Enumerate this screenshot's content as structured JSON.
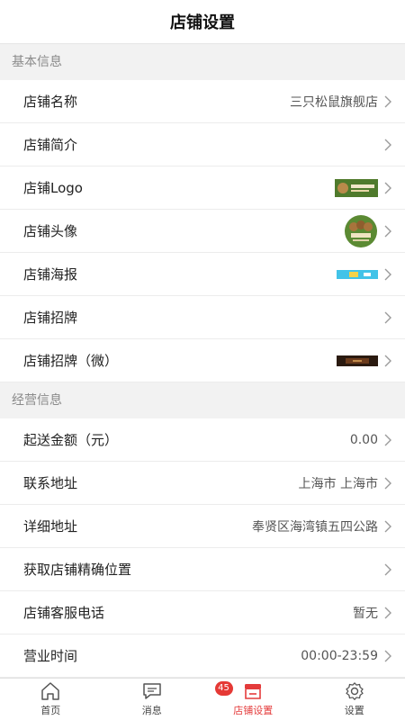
{
  "header": {
    "title": "店铺设置"
  },
  "sections": [
    {
      "title": "基本信息",
      "rows": [
        {
          "label": "店铺名称",
          "value": "三只松鼠旗舰店"
        },
        {
          "label": "店铺简介",
          "value": ""
        },
        {
          "label": "店铺Logo",
          "value": ""
        },
        {
          "label": "店铺头像",
          "value": ""
        },
        {
          "label": "店铺海报",
          "value": ""
        },
        {
          "label": "店铺招牌",
          "value": ""
        },
        {
          "label": "店铺招牌（微）",
          "value": ""
        }
      ]
    },
    {
      "title": "经营信息",
      "rows": [
        {
          "label": "起送金额（元）",
          "value": "0.00"
        },
        {
          "label": "联系地址",
          "value": "上海市 上海市"
        },
        {
          "label": "详细地址",
          "value": "奉贤区海湾镇五四公路"
        },
        {
          "label": "获取店铺精确位置",
          "value": ""
        },
        {
          "label": "店铺客服电话",
          "value": "暂无"
        },
        {
          "label": "营业时间",
          "value": "00:00-23:59"
        }
      ]
    }
  ],
  "tabbar": {
    "items": [
      {
        "label": "首页",
        "icon": "home-icon"
      },
      {
        "label": "消息",
        "icon": "message-icon",
        "badge": "45"
      },
      {
        "label": "店铺设置",
        "icon": "shop-icon",
        "active": true
      },
      {
        "label": "设置",
        "icon": "gear-icon"
      }
    ]
  },
  "colors": {
    "accent": "#e43b3b",
    "badge": "#e53935",
    "background": "#f2f2f2"
  }
}
